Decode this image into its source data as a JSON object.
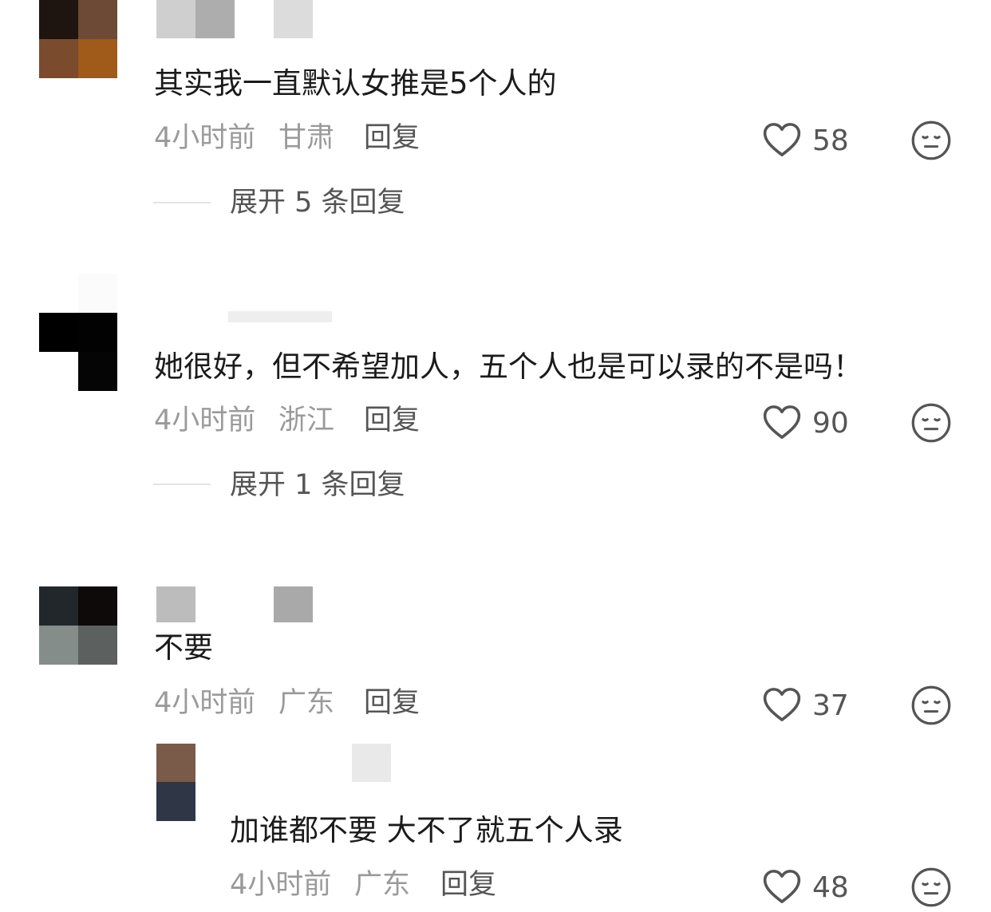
{
  "comments": [
    {
      "text": "其实我一直默认女推是5个人的",
      "time": "4小时前",
      "location": "甘肃",
      "reply_label": "回复",
      "likes": "58",
      "expand_label": "展开 5 条回复",
      "avatar_colors": [
        "#1e1410",
        "#6d4a36",
        "#7a4b2d",
        "#a05a1a"
      ]
    },
    {
      "text": "她很好，但不希望加人，五个人也是可以录的不是吗！",
      "time": "4小时前",
      "location": "浙江",
      "reply_label": "回复",
      "likes": "90",
      "expand_label": "展开 1 条回复",
      "avatar_colors": [
        "#ffffff",
        "#f5f5f5",
        "#000000",
        "#050505"
      ]
    },
    {
      "text": "不要",
      "time": "4小时前",
      "location": "广东",
      "reply_label": "回复",
      "likes": "37",
      "avatar_colors": [
        "#22272b",
        "#0e0a0a",
        "#848d89",
        "#5c605e"
      ]
    }
  ],
  "sub_reply": {
    "text": "加谁都不要 大不了就五个人录",
    "time": "4小时前",
    "location": "广东",
    "reply_label": "回复",
    "likes": "48",
    "avatar_colors": [
      "#7a5a48",
      "#2f3646"
    ]
  },
  "colors": {
    "text": "#1b1b1b",
    "meta": "#9a9a9a",
    "action": "#555555",
    "pixelated_name": "#bdbdbd"
  }
}
